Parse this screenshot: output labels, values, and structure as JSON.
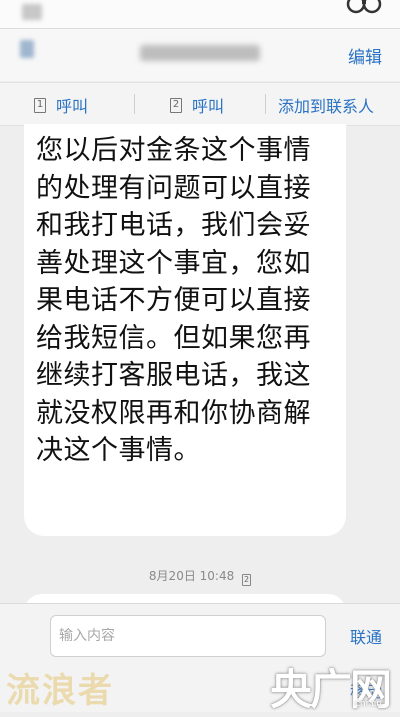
{
  "header": {
    "edit_label": "编辑"
  },
  "actions": {
    "call_sim1_label": "呼叫",
    "call_sim2_label": "呼叫",
    "sim1_number": "1",
    "sim2_number": "2",
    "add_contact_label": "添加到联系人"
  },
  "message": {
    "text": "您以后对金条这个事情的处理有问题可以直接和我打电话，我们会妥善处理这个事宜，您如果电话不方便可以直接给我短信。但如果您再继续打客服电话，我这就没权限再和你协商解决这个事情。",
    "timestamp": "8月20日 10:48",
    "timestamp_sim": "2"
  },
  "composer": {
    "placeholder": "输入内容",
    "send_sim_label": "联通",
    "send_mobile_label": "移动"
  },
  "watermark": {
    "left": "流浪者",
    "right": "央广网",
    "right_sub": "cnr.cn"
  },
  "colors": {
    "accent": "#2a73c4",
    "bubble": "#ffffff",
    "background": "#eeeeee"
  }
}
